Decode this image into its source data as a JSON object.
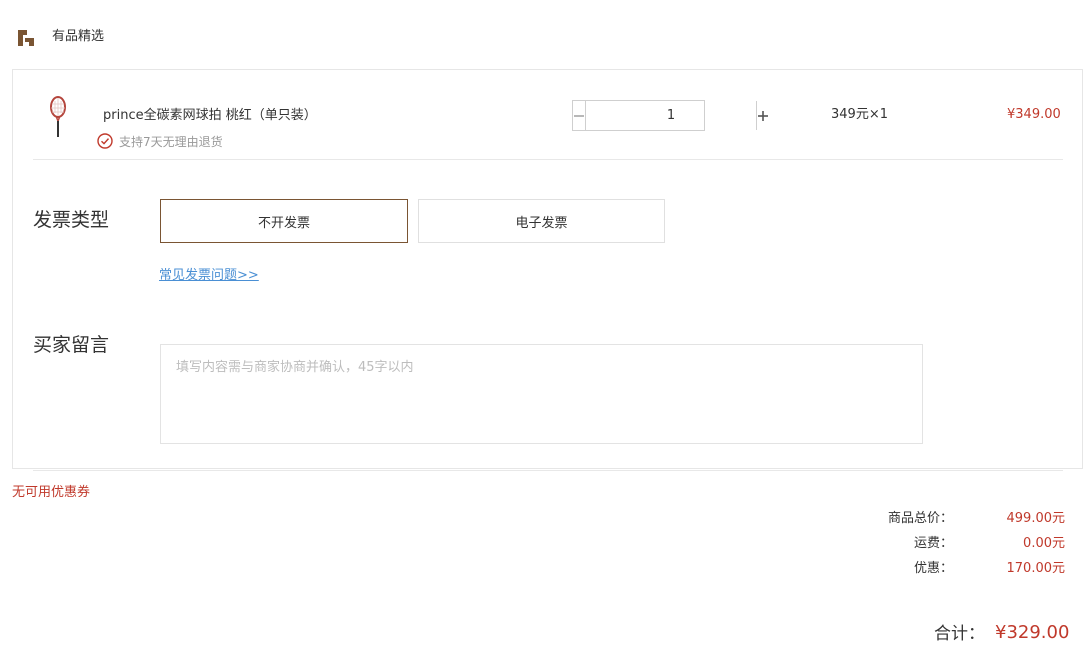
{
  "shop": {
    "name": "有品精选",
    "logo_icon": "shop-logo-icon",
    "logo_color": "#7a5533"
  },
  "item": {
    "image_icon": "tennis-racket-icon",
    "title": "prince全碳素网球拍 桃红（单只装）",
    "return_policy": "支持7天无理由退货",
    "quantity": "1",
    "unit_price": "349元×1",
    "total": "¥349.00"
  },
  "invoice": {
    "label": "发票类型",
    "options": [
      "不开发票",
      "电子发票"
    ],
    "selected": "不开发票",
    "faq_link": "常见发票问题>>"
  },
  "message": {
    "label": "买家留言",
    "placeholder": "填写内容需与商家协商并确认，45字以内"
  },
  "coupon": {
    "note": "无可用优惠券"
  },
  "summary": {
    "rows": [
      {
        "label": "商品总价：",
        "value": "499.00元"
      },
      {
        "label": "运费：",
        "value": "0.00元"
      },
      {
        "label": "优惠：",
        "value": "170.00元"
      }
    ],
    "total_label": "合计：",
    "total_value": "¥329.00"
  },
  "colors": {
    "accent": "#c0392b",
    "brand": "#7a5533",
    "link": "#4a8fd4"
  }
}
